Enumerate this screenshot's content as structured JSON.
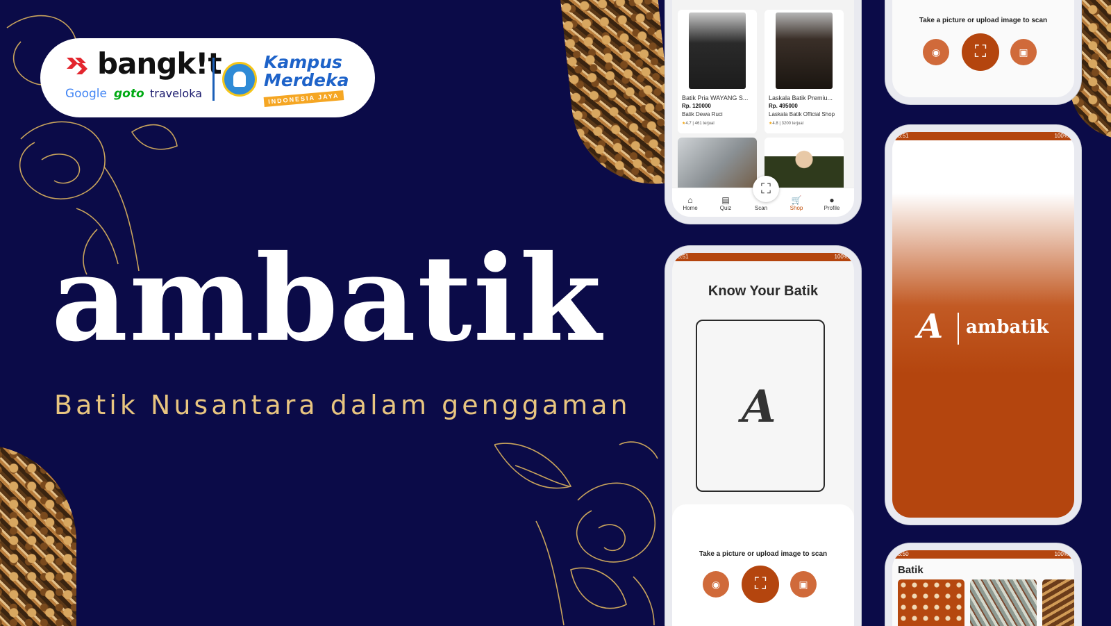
{
  "hero": {
    "title": "ambatik",
    "tagline": "Batik Nusantara dalam genggaman"
  },
  "logos": {
    "bangkit": "bangk!t",
    "partners": [
      "Google",
      "goto",
      "traveloka"
    ],
    "kampus_line1": "Kampus",
    "kampus_line2": "Merdeka",
    "kampus_band": "INDONESIA JAYA"
  },
  "status_bar": {
    "time_a": "3:51",
    "time_b": "3:50",
    "battery": "100%"
  },
  "shop": {
    "products": [
      {
        "name": "Batik Pria WAYANG S...",
        "price": "Rp. 120000",
        "store": "Batik Dewa Ruci",
        "rating": "4.7",
        "sold": "461 terjual"
      },
      {
        "name": "Laskala Batik Premiu...",
        "price": "Rp. 495000",
        "store": "Laskala Batik Official Shop",
        "rating": "4.8",
        "sold": "3200 terjual"
      }
    ],
    "nav": [
      {
        "label": "Home",
        "icon": "home-icon"
      },
      {
        "label": "Quiz",
        "icon": "book-icon"
      },
      {
        "label": "Scan",
        "icon": "scan-icon"
      },
      {
        "label": "Shop",
        "icon": "cart-icon"
      },
      {
        "label": "Profile",
        "icon": "person-icon"
      }
    ],
    "active_tab": "Shop"
  },
  "scanner": {
    "title": "Know Your Batik",
    "hint": "Take a picture or upload image to scan",
    "logo_glyph": "A"
  },
  "splash": {
    "logo_glyph": "A",
    "name": "ambatik"
  },
  "batik_list": {
    "title": "Batik"
  },
  "colors": {
    "background": "#0b0b48",
    "accent": "#b4450e",
    "gold": "#e8c580"
  }
}
